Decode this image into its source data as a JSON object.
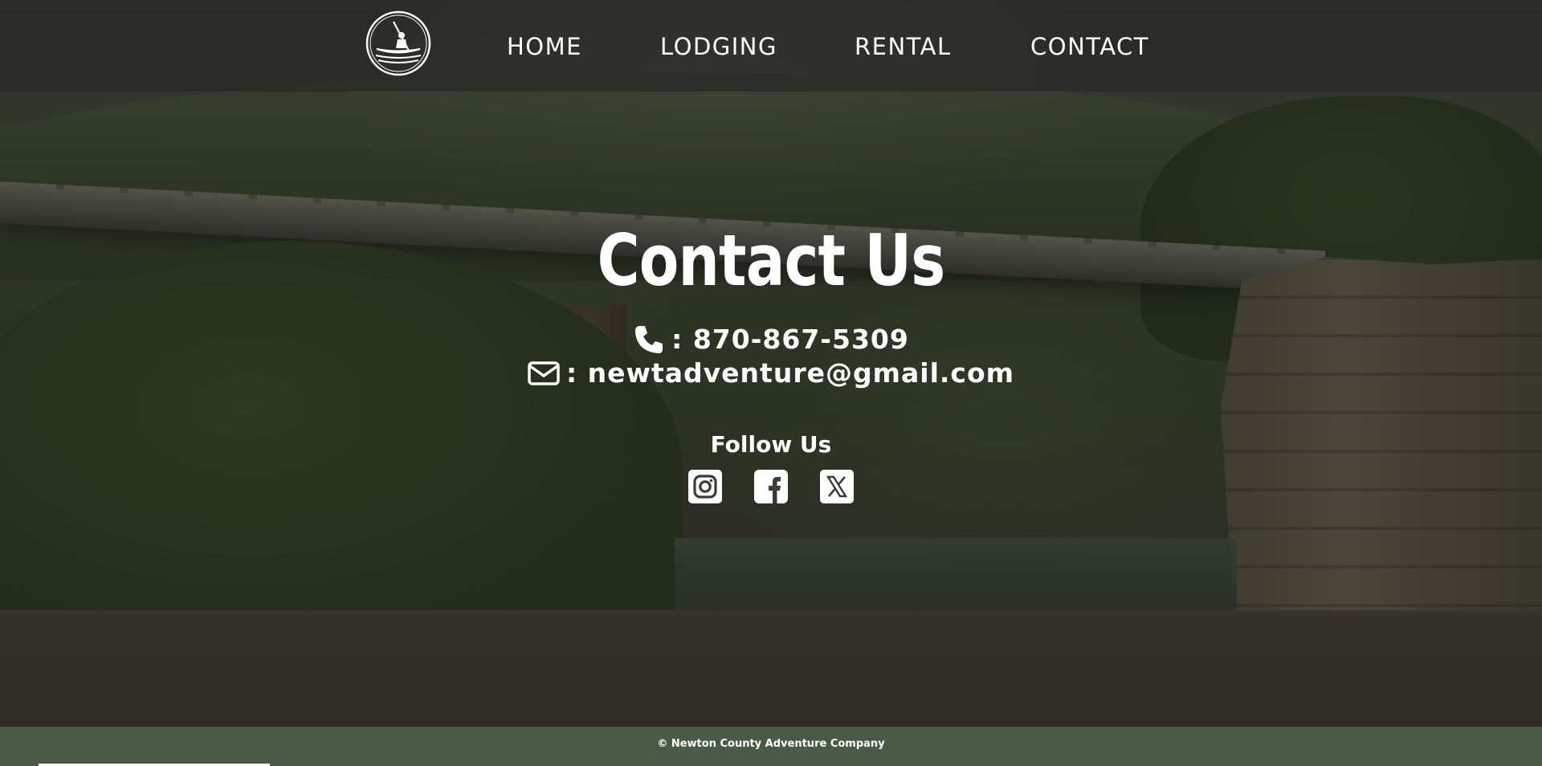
{
  "nav": {
    "items": [
      {
        "label": "HOME"
      },
      {
        "label": "LODGING"
      },
      {
        "label": "RENTAL"
      },
      {
        "label": "CONTACT"
      }
    ]
  },
  "main": {
    "title": "Contact Us",
    "phone": {
      "prefix": ": ",
      "value": "870-867-5309",
      "icon": "phone-icon"
    },
    "email": {
      "prefix": ": ",
      "value": "newtadventure@gmail.com",
      "icon": "envelope-icon"
    },
    "follow_title": "Follow Us",
    "social": [
      "instagram-icon",
      "facebook-icon",
      "x-icon"
    ]
  },
  "footer": {
    "text": "© Newton County Adventure Company"
  },
  "colors": {
    "header_bg": "#282828",
    "footer_bg": "#4a5a47",
    "text": "#ffffff"
  }
}
